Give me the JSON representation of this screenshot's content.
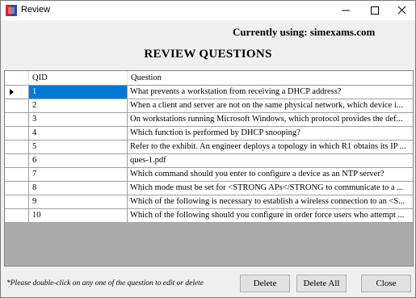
{
  "window": {
    "title": "Review",
    "icon": "app-icon",
    "controls": [
      "minimize-icon",
      "maximize-icon",
      "close-icon"
    ]
  },
  "currently_using": "Currently using: simexams.com",
  "heading": "REVIEW QUESTIONS",
  "grid": {
    "columns": [
      "QID",
      "Question"
    ],
    "selected_row": 0,
    "rows": [
      {
        "qid": "1",
        "question": "What prevents a workstation from receiving a DHCP address?"
      },
      {
        "qid": "2",
        "question": "When a client and server are not on the same physical network, which device i..."
      },
      {
        "qid": "3",
        "question": "On workstations running Microsoft Windows, which protocol provides the def..."
      },
      {
        "qid": "4",
        "question": "Which function is performed by DHCP snooping?"
      },
      {
        "qid": "5",
        "question": "Refer to the exhibit. An engineer deploys a topology in which R1 obtains its IP ..."
      },
      {
        "qid": "6",
        "question": "ques-1.pdf"
      },
      {
        "qid": "7",
        "question": "Which command should you enter to configure a device as an NTP server?"
      },
      {
        "qid": "8",
        "question": "Which mode must be set for <STRONG APs</STRONG  to communicate to a ..."
      },
      {
        "qid": "9",
        "question": "Which of the following is necessary to establish a wireless connection to an <S..."
      },
      {
        "qid": "10",
        "question": "Which of the following should you configure in order force users who attempt ..."
      }
    ]
  },
  "hint": "*Please double-click on any one of the question to edit or delete",
  "buttons": {
    "delete": "Delete",
    "delete_all": "Delete All",
    "close": "Close"
  }
}
